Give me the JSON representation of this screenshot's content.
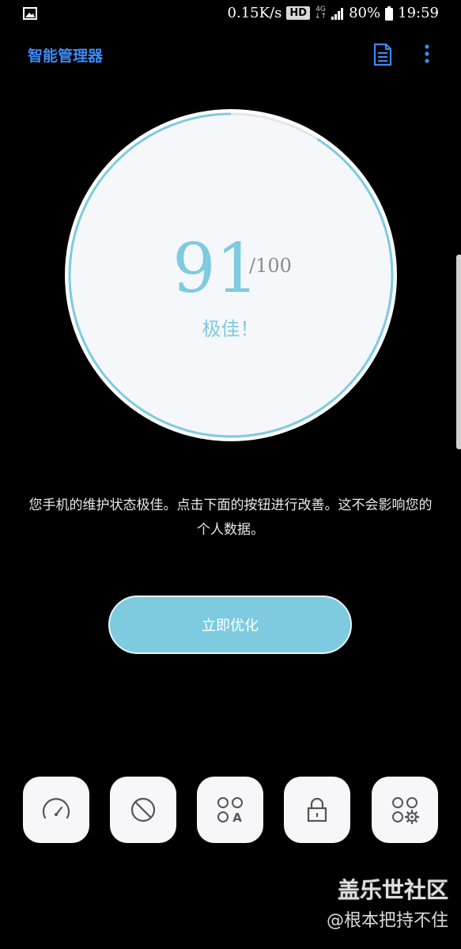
{
  "status_bar": {
    "speed": "0.15K/s",
    "hd": "HD",
    "network": "4G",
    "battery": "80%",
    "time": "19:59"
  },
  "app_bar": {
    "title": "智能管理器"
  },
  "score": {
    "value": "91",
    "max": "/100",
    "status": "极佳！",
    "progress": 0.91
  },
  "description": "您手机的维护状态极佳。点击下面的按钮进行改善。这不会影响您的个人数据。",
  "optimize_button": {
    "label": "立即优化"
  },
  "tools": [
    {
      "icon": "speedometer-icon"
    },
    {
      "icon": "block-icon"
    },
    {
      "icon": "apps-a-icon"
    },
    {
      "icon": "lock-icon"
    },
    {
      "icon": "apps-settings-icon"
    }
  ],
  "watermark": {
    "brand": "盖乐世社区",
    "user": "@根本把持不住"
  },
  "colors": {
    "accent": "#7ecbe0",
    "title": "#3d8bf5",
    "background": "#000000"
  }
}
